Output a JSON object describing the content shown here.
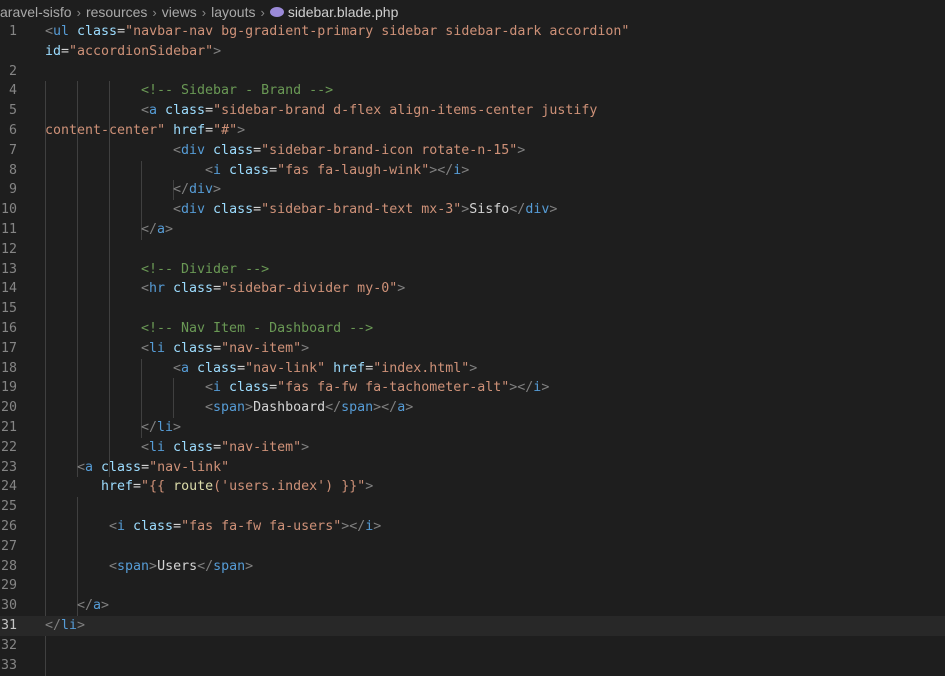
{
  "breadcrumb": [
    "aravel-sisfo",
    "resources",
    "views",
    "layouts"
  ],
  "breadcrumb_sep": "›",
  "file": {
    "name": "sidebar.blade.php",
    "icon": "php-elephant-icon"
  },
  "current_line": 31,
  "colors": {
    "background": "#1e1e1e",
    "tag": "#569cd6",
    "attribute": "#9cdcfe",
    "string": "#ce9178",
    "comment": "#6a9955",
    "text": "#d4d4d4",
    "line_number": "#858585"
  },
  "lines": [
    {
      "n": "1",
      "s": [
        [
          "p",
          "<"
        ],
        [
          "g",
          "ul"
        ],
        [
          "a",
          " class"
        ],
        [
          "x",
          "="
        ],
        [
          "s",
          "\"navbar-nav bg-gradient-primary sidebar sidebar-dark accordion\""
        ]
      ]
    },
    {
      "n": "",
      "s": [
        [
          "a",
          "id"
        ],
        [
          "x",
          "="
        ],
        [
          "s",
          "\"accordionSidebar\""
        ],
        [
          "p",
          ">"
        ]
      ]
    },
    {
      "n": "2",
      "s": []
    },
    {
      "n": "4",
      "s": [
        [
          "c",
          "<!-- Sidebar - Brand -->"
        ]
      ]
    },
    {
      "n": "5",
      "s": [
        [
          "p",
          "<"
        ],
        [
          "g",
          "a"
        ],
        [
          "a",
          " class"
        ],
        [
          "x",
          "="
        ],
        [
          "s",
          "\"sidebar-brand d-flex align-items-center justify"
        ]
      ]
    },
    {
      "n": "6",
      "s": [
        [
          "s",
          "content-center\""
        ],
        [
          "a",
          " href"
        ],
        [
          "x",
          "="
        ],
        [
          "s",
          "\"#\""
        ],
        [
          "p",
          ">"
        ]
      ]
    },
    {
      "n": "7",
      "s": [
        [
          "p",
          "<"
        ],
        [
          "g",
          "div"
        ],
        [
          "a",
          " class"
        ],
        [
          "x",
          "="
        ],
        [
          "s",
          "\"sidebar-brand-icon rotate-n-15\""
        ],
        [
          "p",
          ">"
        ]
      ]
    },
    {
      "n": "8",
      "s": [
        [
          "p",
          "<"
        ],
        [
          "g",
          "i"
        ],
        [
          "a",
          " class"
        ],
        [
          "x",
          "="
        ],
        [
          "s",
          "\"fas fa-laugh-wink\""
        ],
        [
          "p",
          "></"
        ],
        [
          "g",
          "i"
        ],
        [
          "p",
          ">"
        ]
      ]
    },
    {
      "n": "9",
      "s": [
        [
          "p",
          "</"
        ],
        [
          "g",
          "div"
        ],
        [
          "p",
          ">"
        ]
      ]
    },
    {
      "n": "10",
      "s": [
        [
          "p",
          "<"
        ],
        [
          "g",
          "div"
        ],
        [
          "a",
          " class"
        ],
        [
          "x",
          "="
        ],
        [
          "s",
          "\"sidebar-brand-text mx-3\""
        ],
        [
          "p",
          ">"
        ],
        [
          "x",
          "Sisfo"
        ],
        [
          "p",
          "</"
        ],
        [
          "g",
          "div"
        ],
        [
          "p",
          ">"
        ]
      ]
    },
    {
      "n": "11",
      "s": [
        [
          "p",
          "</"
        ],
        [
          "g",
          "a"
        ],
        [
          "p",
          ">"
        ]
      ]
    },
    {
      "n": "12",
      "s": []
    },
    {
      "n": "13",
      "s": [
        [
          "c",
          "<!-- Divider -->"
        ]
      ]
    },
    {
      "n": "14",
      "s": [
        [
          "p",
          "<"
        ],
        [
          "g",
          "hr"
        ],
        [
          "a",
          " class"
        ],
        [
          "x",
          "="
        ],
        [
          "s",
          "\"sidebar-divider my-0\""
        ],
        [
          "p",
          ">"
        ]
      ]
    },
    {
      "n": "15",
      "s": []
    },
    {
      "n": "16",
      "s": [
        [
          "c",
          "<!-- Nav Item - Dashboard -->"
        ]
      ]
    },
    {
      "n": "17",
      "s": [
        [
          "p",
          "<"
        ],
        [
          "g",
          "li"
        ],
        [
          "a",
          " class"
        ],
        [
          "x",
          "="
        ],
        [
          "s",
          "\"nav-item\""
        ],
        [
          "p",
          ">"
        ]
      ]
    },
    {
      "n": "18",
      "s": [
        [
          "p",
          "<"
        ],
        [
          "g",
          "a"
        ],
        [
          "a",
          " class"
        ],
        [
          "x",
          "="
        ],
        [
          "s",
          "\"nav-link\""
        ],
        [
          "a",
          " href"
        ],
        [
          "x",
          "="
        ],
        [
          "s",
          "\"index.html\""
        ],
        [
          "p",
          ">"
        ]
      ]
    },
    {
      "n": "19",
      "s": [
        [
          "p",
          "<"
        ],
        [
          "g",
          "i"
        ],
        [
          "a",
          " class"
        ],
        [
          "x",
          "="
        ],
        [
          "s",
          "\"fas fa-fw fa-tachometer-alt\""
        ],
        [
          "p",
          "></"
        ],
        [
          "g",
          "i"
        ],
        [
          "p",
          ">"
        ]
      ]
    },
    {
      "n": "20",
      "s": [
        [
          "p",
          "<"
        ],
        [
          "g",
          "span"
        ],
        [
          "p",
          ">"
        ],
        [
          "x",
          "Dashboard"
        ],
        [
          "p",
          "</"
        ],
        [
          "g",
          "span"
        ],
        [
          "p",
          "></"
        ],
        [
          "g",
          "a"
        ],
        [
          "p",
          ">"
        ]
      ]
    },
    {
      "n": "21",
      "s": [
        [
          "p",
          "</"
        ],
        [
          "g",
          "li"
        ],
        [
          "p",
          ">"
        ]
      ]
    },
    {
      "n": "22",
      "s": [
        [
          "p",
          "<"
        ],
        [
          "g",
          "li"
        ],
        [
          "a",
          " class"
        ],
        [
          "x",
          "="
        ],
        [
          "s",
          "\"nav-item\""
        ],
        [
          "p",
          ">"
        ]
      ]
    },
    {
      "n": "23",
      "s": [
        [
          "p",
          "<"
        ],
        [
          "g",
          "a"
        ],
        [
          "a",
          " class"
        ],
        [
          "x",
          "="
        ],
        [
          "s",
          "\"nav-link\""
        ]
      ]
    },
    {
      "n": "24",
      "s": [
        [
          "a",
          "href"
        ],
        [
          "x",
          "="
        ],
        [
          "s",
          "\"{{ "
        ],
        [
          "f",
          "route"
        ],
        [
          "s",
          "('users.index') }}\""
        ],
        [
          "p",
          ">"
        ]
      ]
    },
    {
      "n": "25",
      "s": []
    },
    {
      "n": "26",
      "s": [
        [
          "p",
          "<"
        ],
        [
          "g",
          "i"
        ],
        [
          "a",
          " class"
        ],
        [
          "x",
          "="
        ],
        [
          "s",
          "\"fas fa-fw fa-users\""
        ],
        [
          "p",
          "></"
        ],
        [
          "g",
          "i"
        ],
        [
          "p",
          ">"
        ]
      ]
    },
    {
      "n": "27",
      "s": []
    },
    {
      "n": "28",
      "s": [
        [
          "p",
          "<"
        ],
        [
          "g",
          "span"
        ],
        [
          "p",
          ">"
        ],
        [
          "x",
          "Users"
        ],
        [
          "p",
          "</"
        ],
        [
          "g",
          "span"
        ],
        [
          "p",
          ">"
        ]
      ]
    },
    {
      "n": "29",
      "s": []
    },
    {
      "n": "30",
      "s": [
        [
          "p",
          "</"
        ],
        [
          "g",
          "a"
        ],
        [
          "p",
          ">"
        ]
      ]
    },
    {
      "n": "31",
      "s": [
        [
          "p",
          "</"
        ],
        [
          "g",
          "li"
        ],
        [
          "p",
          ">"
        ]
      ]
    },
    {
      "n": "32",
      "s": []
    },
    {
      "n": "33",
      "s": []
    }
  ]
}
